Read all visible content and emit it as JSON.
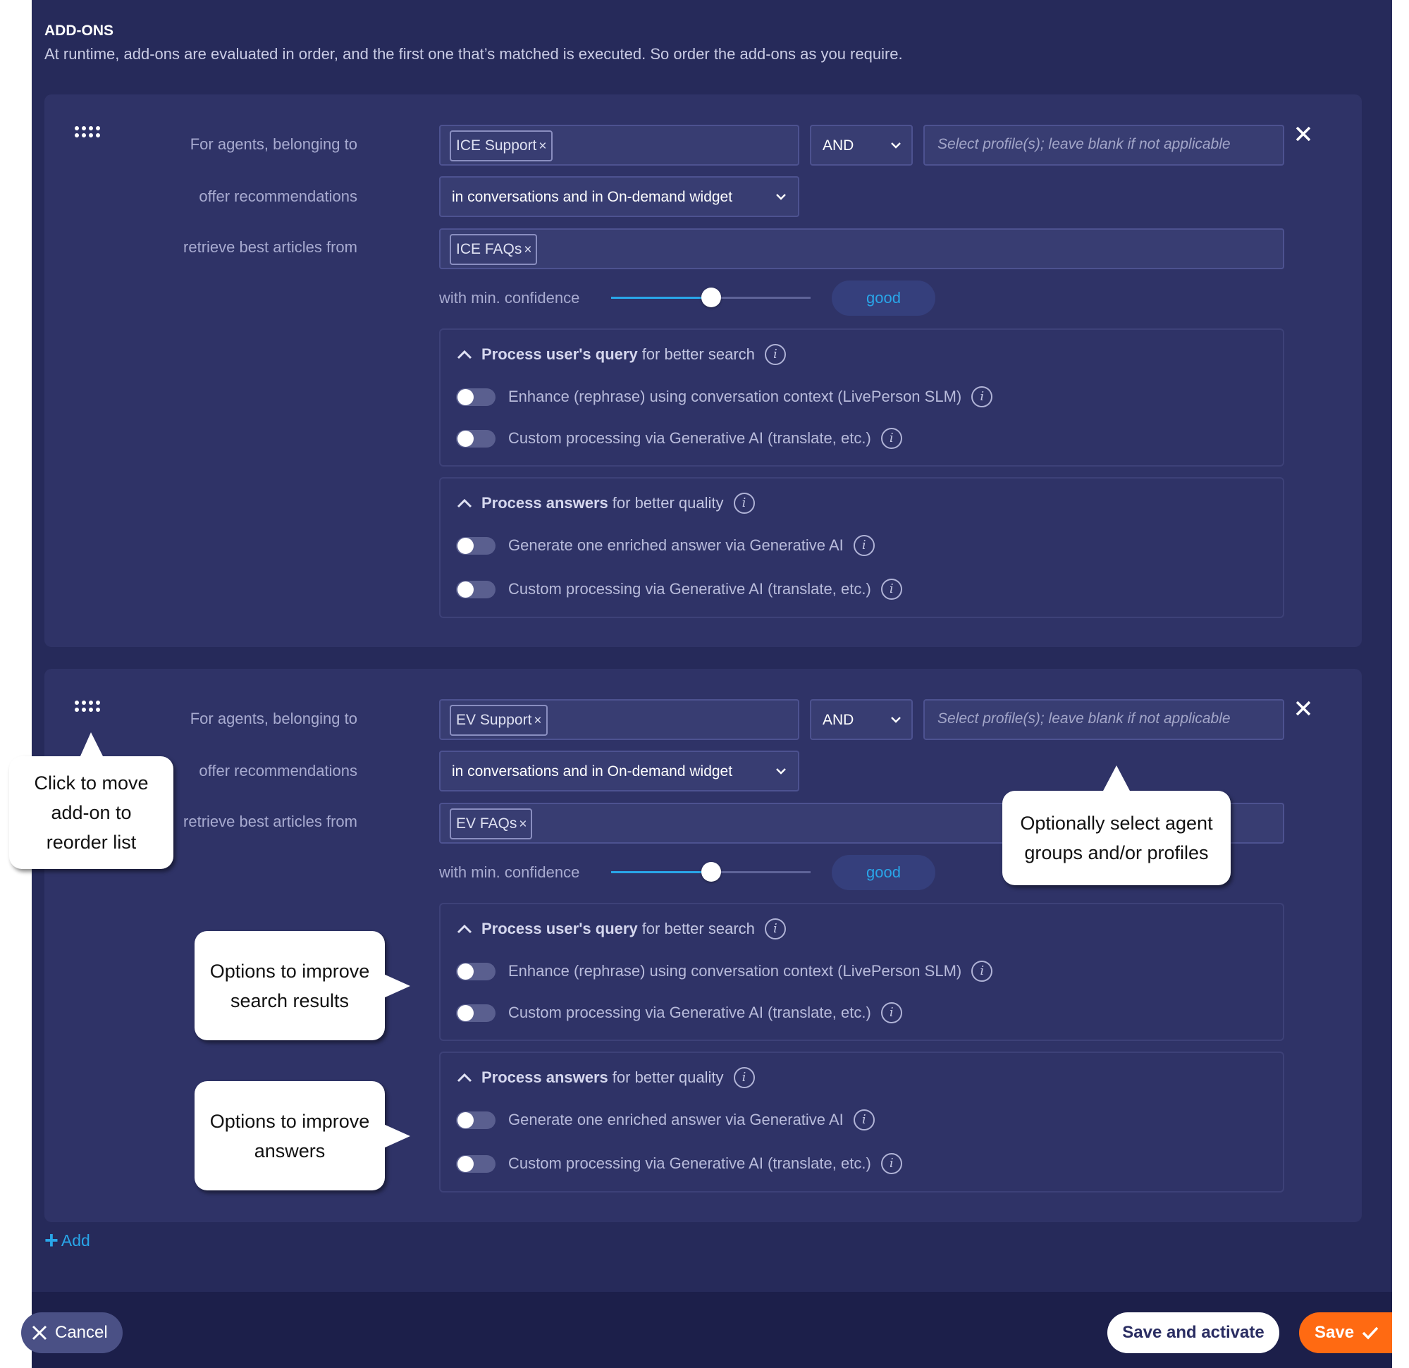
{
  "section": {
    "title": "ADD-ONS",
    "description": "At runtime, add-ons are evaluated in order, and the first one that’s matched is executed. So order the add-ons as you require."
  },
  "labels": {
    "agents": "For agents, belonging to",
    "offer": "offer recommendations",
    "retrieve": "retrieve best articles from",
    "confidence": "with min. confidence"
  },
  "addons": [
    {
      "group_chip": "ICE Support",
      "operator": "AND",
      "profile_placeholder": "Select profile(s); leave blank if not applicable",
      "offer_value": "in conversations and in On-demand widget",
      "kb_chip": "ICE FAQs",
      "confidence_label": "good",
      "confidence_level": 0.5,
      "query_panel": {
        "title_bold": "Process user's query",
        "title_rest": "for better search",
        "options": [
          {
            "label": "Enhance (rephrase) using conversation context (LivePerson SLM)",
            "enabled": false
          },
          {
            "label": "Custom processing via Generative AI (translate, etc.)",
            "enabled": false
          }
        ]
      },
      "answers_panel": {
        "title_bold": "Process answers",
        "title_rest": "for better quality",
        "options": [
          {
            "label": "Generate one enriched answer via Generative AI",
            "enabled": false
          },
          {
            "label": "Custom processing via Generative AI (translate, etc.)",
            "enabled": false
          }
        ]
      }
    },
    {
      "group_chip": "EV Support",
      "operator": "AND",
      "profile_placeholder": "Select profile(s); leave blank if not applicable",
      "offer_value": "in conversations and in On-demand widget",
      "kb_chip": "EV FAQs",
      "confidence_label": "good",
      "confidence_level": 0.5,
      "query_panel": {
        "title_bold": "Process user's query",
        "title_rest": "for better search",
        "options": [
          {
            "label": "Enhance (rephrase) using conversation context (LivePerson SLM)",
            "enabled": false
          },
          {
            "label": "Custom processing via Generative AI (translate, etc.)",
            "enabled": false
          }
        ]
      },
      "answers_panel": {
        "title_bold": "Process answers",
        "title_rest": "for better quality",
        "options": [
          {
            "label": "Generate one enriched answer via Generative AI",
            "enabled": false
          },
          {
            "label": "Custom processing via Generative AI (translate, etc.)",
            "enabled": false
          }
        ]
      }
    }
  ],
  "chip_remove_glyph": "×",
  "info_glyph": "i",
  "add_label": "Add",
  "footer": {
    "cancel_label": "Cancel",
    "save_activate_label": "Save and activate",
    "save_label": "Save"
  },
  "callouts": {
    "reorder": [
      "Click to move",
      "add-on to",
      "reorder list"
    ],
    "profiles": [
      "Optionally select agent",
      "groups and/or profiles"
    ],
    "search": [
      "Options to improve",
      "search results"
    ],
    "answers": [
      "Options to improve",
      "answers"
    ]
  },
  "icons": {
    "drag": "drag-handle-icon",
    "close": "close-icon",
    "chevron": "chevron-down-icon",
    "collapse": "chevron-up-icon",
    "info": "info-icon",
    "plus": "plus-icon",
    "check": "check-icon"
  },
  "colors": {
    "background": "#262a5a",
    "card": "#2f3367",
    "accent": "#29a6e9",
    "save": "#ff6a12"
  }
}
